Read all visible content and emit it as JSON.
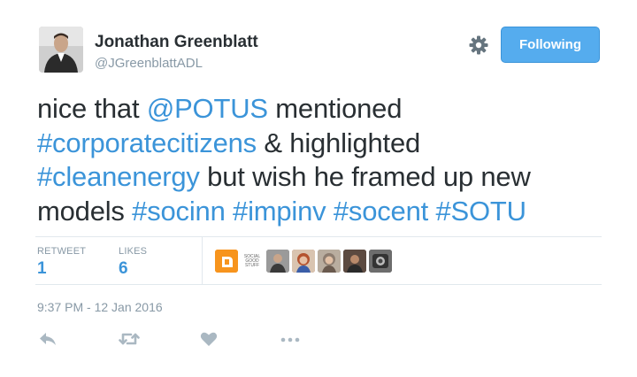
{
  "author": {
    "name": "Jonathan Greenblatt",
    "handle": "@JGreenblattADL",
    "avatar_icon": "profile-photo"
  },
  "header": {
    "settings_icon": "gear-icon",
    "follow_label": "Following"
  },
  "tweet": {
    "parts": [
      "nice that ",
      "@POTUS",
      " mentioned ",
      "#corporatecitizens",
      " & highlighted ",
      "#cleanenergy",
      " but wish he framed up new models ",
      "#socinn",
      " ",
      "#impinv",
      " ",
      "#socent",
      " ",
      "#SOTU"
    ]
  },
  "stats": {
    "retweets_label": "RETWEET",
    "retweets_value": "1",
    "likes_label": "LIKES",
    "likes_value": "6"
  },
  "likers": [
    {
      "name": "orange-logo-liker",
      "color": "#f7941d"
    },
    {
      "name": "text-logo-liker",
      "text": "SOCIAL GOOD STUFF"
    },
    {
      "name": "man-glasses-liker",
      "color": "#6b6b6b"
    },
    {
      "name": "woman-red-hair-liker",
      "color": "#a8583a"
    },
    {
      "name": "woman-gray-hair-liker",
      "color": "#8c7a6a"
    },
    {
      "name": "man-dark-liker",
      "color": "#4a3a32"
    },
    {
      "name": "bw-photo-liker",
      "color": "#555555"
    }
  ],
  "timestamp": "9:37 PM - 12 Jan 2016",
  "actions": [
    "reply-icon",
    "retweet-icon",
    "like-icon",
    "more-icon"
  ],
  "colors": {
    "link": "#3b94d9",
    "button": "#55acee",
    "muted": "#8899a6",
    "text": "#292f33"
  }
}
